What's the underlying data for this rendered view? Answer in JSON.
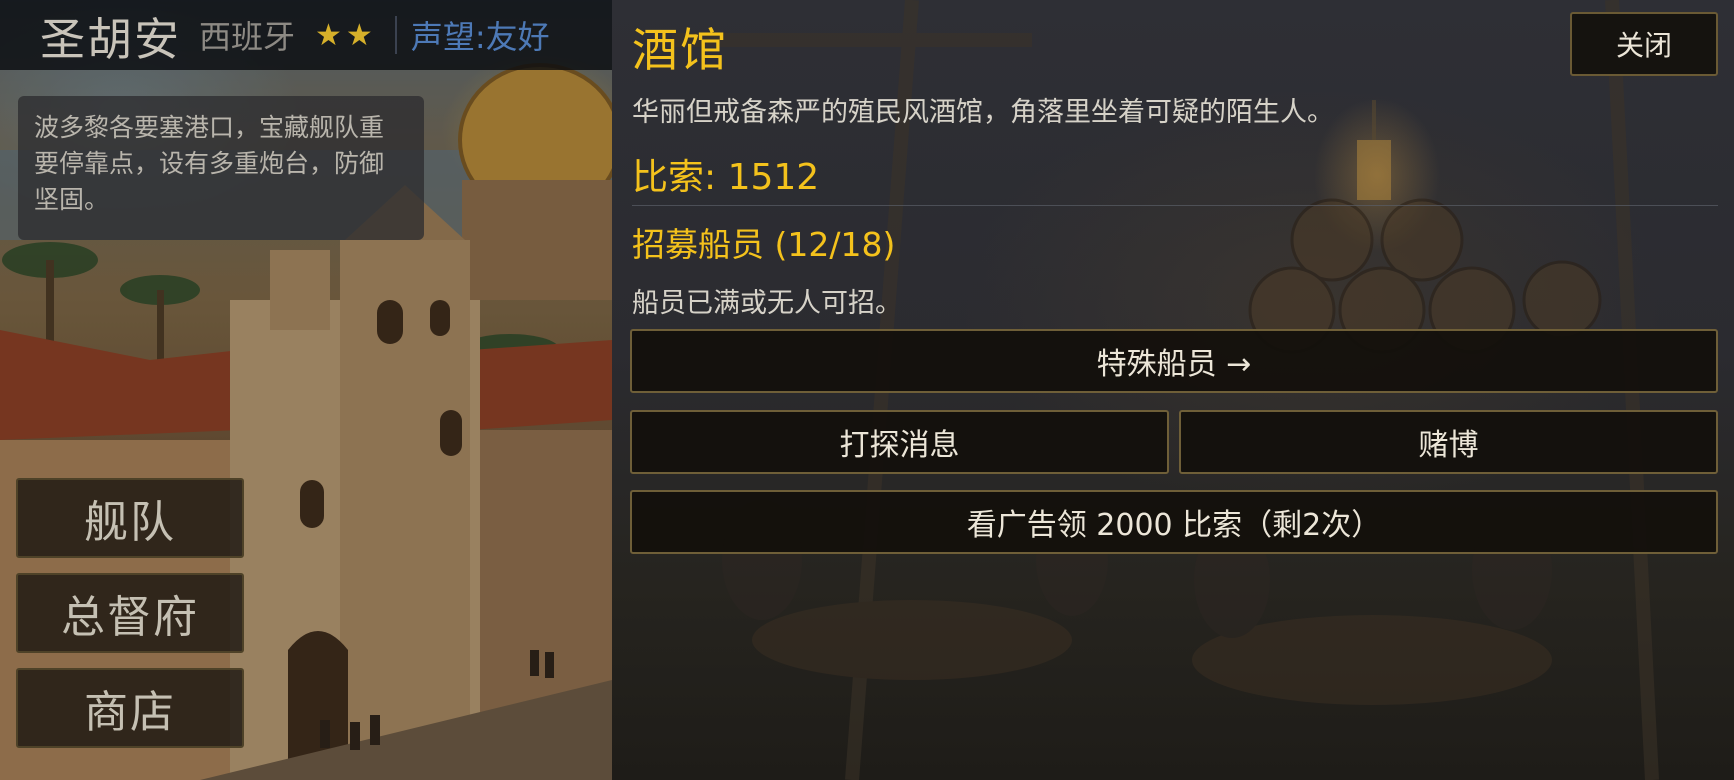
{
  "town": {
    "name": "圣胡安",
    "nation": "西班牙",
    "stars": "★★",
    "reputation": "声望:友好",
    "description": "波多黎各要塞港口，宝藏舰队重要停靠点，设有多重炮台，防御坚固。"
  },
  "side_menu": {
    "fleet": "舰队",
    "governor": "总督府",
    "shop": "商店"
  },
  "tavern": {
    "title": "酒馆",
    "close_label": "关闭",
    "description": "华丽但戒备森严的殖民风酒馆，角落里坐着可疑的陌生人。",
    "gold_text": "比索: 1512",
    "recruit_title": "招募船员 (12/18)",
    "recruit_status": "船员已满或无人可招。",
    "buttons": {
      "special_crew": "特殊船员 →",
      "gossip": "打探消息",
      "gamble": "赌博",
      "watch_ad": "看广告领 2000 比索（剩2次）"
    }
  },
  "colors": {
    "accent_gold": "#f4c21c",
    "reputation_blue": "#4d79b6",
    "star_gold": "#d6b02a",
    "button_border": "#6f5f38"
  }
}
